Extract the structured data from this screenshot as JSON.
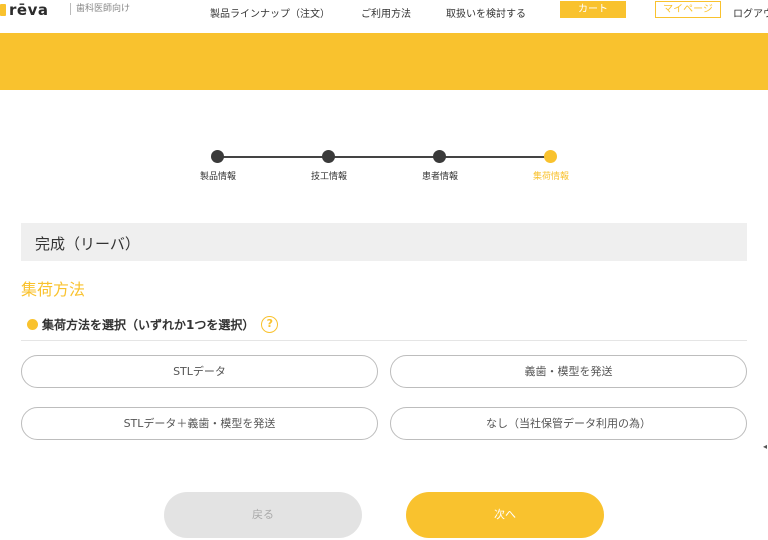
{
  "header": {
    "logo": "rēva",
    "logo_sub": "歯科医師向け",
    "nav": [
      {
        "label": "製品ラインナップ（注文）"
      },
      {
        "label": "ご利用方法"
      },
      {
        "label": "取扱いを検討する"
      }
    ],
    "cart_label": "カート",
    "mypage_label": "マイページ",
    "logout_label": "ログアウ"
  },
  "stepper": {
    "steps": [
      {
        "label": "製品情報",
        "state": "done"
      },
      {
        "label": "技工情報",
        "state": "done"
      },
      {
        "label": "患者情報",
        "state": "done"
      },
      {
        "label": "集荷情報",
        "state": "active"
      }
    ]
  },
  "product": {
    "name": "完成（リーバ）"
  },
  "section": {
    "title": "集荷方法",
    "question": "集荷方法を選択（いずれか1つを選択）",
    "help": "?",
    "options": [
      {
        "label": "STLデータ"
      },
      {
        "label": "義歯・模型を発送"
      },
      {
        "label": "STLデータ＋義歯・模型を発送"
      },
      {
        "label": "なし（当社保管データ利用の為）"
      }
    ]
  },
  "actions": {
    "back_label": "戻る",
    "next_label": "次へ"
  },
  "colors": {
    "accent": "#f9c22e",
    "dark": "#3a3a3a",
    "panel": "#efefef"
  }
}
